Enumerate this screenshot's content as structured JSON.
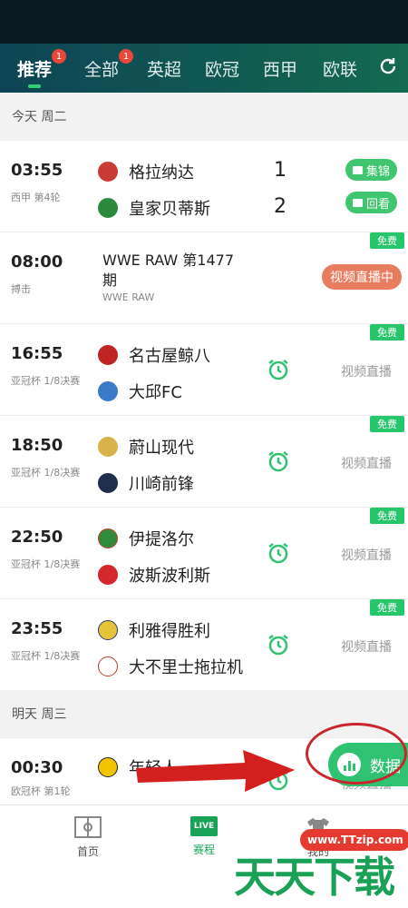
{
  "tabs": [
    {
      "label": "推荐",
      "badge": "1"
    },
    {
      "label": "全部",
      "badge": "1"
    },
    {
      "label": "英超"
    },
    {
      "label": "欧冠"
    },
    {
      "label": "西甲"
    },
    {
      "label": "欧联"
    }
  ],
  "sections": [
    {
      "date": "今天 周二"
    },
    {
      "date": "明天 周三"
    }
  ],
  "matches": [
    {
      "time": "03:55",
      "league": "西甲 第4轮",
      "home": "格拉纳达",
      "away": "皇家贝蒂斯",
      "home_score": "1",
      "away_score": "2",
      "action1": "集锦",
      "action2": "回看"
    },
    {
      "time": "08:00",
      "league": "搏击",
      "title": "WWE RAW 第1477期",
      "subtitle": "WWE RAW",
      "free": "免费",
      "live": "视频直播中"
    },
    {
      "time": "16:55",
      "league": "亚冠杯 1/8决赛",
      "home": "名古屋鲸八",
      "away": "大邱FC",
      "free": "免费",
      "stream": "视频直播"
    },
    {
      "time": "18:50",
      "league": "亚冠杯 1/8决赛",
      "home": "蔚山现代",
      "away": "川崎前锋",
      "free": "免费",
      "stream": "视频直播"
    },
    {
      "time": "22:50",
      "league": "亚冠杯 1/8决赛",
      "home": "伊提洛尔",
      "away": "波斯波利斯",
      "free": "免费",
      "stream": "视频直播"
    },
    {
      "time": "23:55",
      "league": "亚冠杯 1/8决赛",
      "home": "利雅得胜利",
      "away": "大不里士拖拉机",
      "free": "免费",
      "stream": "视频直播"
    },
    {
      "time": "00:30",
      "league": "欧冠杯 第1轮",
      "home": "年轻人",
      "stream": "视频直播"
    }
  ],
  "data_button": {
    "label": "数据"
  },
  "bottom_nav": [
    {
      "label": "首页"
    },
    {
      "label": "赛程",
      "live": "LIVE"
    },
    {
      "label": "我的"
    }
  ],
  "watermark": {
    "url": "www.TTzip.com",
    "text": "天天下载"
  },
  "colors": {
    "accent": "#2dcf71",
    "header_start": "#0e4455",
    "header_end": "#136a4f",
    "live_pill": "#e87c5e",
    "annotation": "#c9272b"
  }
}
